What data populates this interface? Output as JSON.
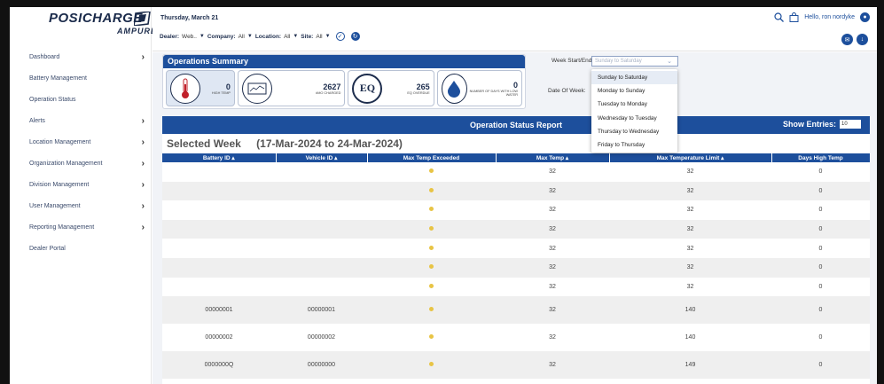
{
  "app": {
    "brand": "POSICHARGE",
    "sub_brand": "AMPURE"
  },
  "sidebar": {
    "items": [
      {
        "label": "Dashboard",
        "chevron": true
      },
      {
        "label": "Battery Management",
        "chevron": false
      },
      {
        "label": "Operation Status",
        "chevron": false
      },
      {
        "label": "Alerts",
        "chevron": true
      },
      {
        "label": "Location Management",
        "chevron": true
      },
      {
        "label": "Organization Management",
        "chevron": true
      },
      {
        "label": "Division Management",
        "chevron": true
      },
      {
        "label": "User Management",
        "chevron": true
      },
      {
        "label": "Reporting Management",
        "chevron": true
      },
      {
        "label": "Dealer Portal",
        "chevron": false
      }
    ]
  },
  "header": {
    "date": "Thursday, March 21",
    "greeting": "Hello, ron nordyke",
    "filters": {
      "dealer_label": "Dealer:",
      "dealer_value": "Web..",
      "company_label": "Company:",
      "company_value": "All",
      "location_label": "Location:",
      "location_value": "All",
      "site_label": "Site:",
      "site_value": "All"
    }
  },
  "operations_summary": {
    "title": "Operations Summary",
    "cards": [
      {
        "icon": "thermometer-icon",
        "value": "0",
        "label": "HIGH TEMP"
      },
      {
        "icon": "battery-chart-icon",
        "value": "2627",
        "label": "#mo Charged"
      },
      {
        "icon": "eq-icon",
        "value": "265",
        "label": "EQ OVERDUE"
      },
      {
        "icon": "water-drop-icon",
        "value": "0",
        "label": "NUMBER OF DAYS WITH LOW WATER"
      }
    ]
  },
  "week_filter": {
    "label": "Week Start/End:",
    "placeholder": "Sunday to Saturday",
    "date_of_week_label": "Date Of Week:",
    "options": [
      "Sunday to Saturday",
      "Monday to Sunday",
      "Tuesday to Monday",
      "Wednesday to Tuesday",
      "Thursday to Wednesday",
      "Friday to Thursday"
    ],
    "highlighted_index": 0
  },
  "report": {
    "title": "Operation Status Report",
    "show_entries_label": "Show Entries:",
    "show_entries_value": "10",
    "selected_week_label": "Selected Week",
    "selected_week_range": "(17-Mar-2024 to 24-Mar-2024)",
    "columns": [
      "Battery ID ▴",
      "Vehicle ID ▴",
      "Max Temp Exceeded",
      "Max Temp ▴",
      "Max Temperature Limit ▴",
      "Days High Temp"
    ],
    "rows": [
      {
        "battery": "",
        "vehicle": "",
        "max_temp": "32",
        "limit": "32",
        "days": "0"
      },
      {
        "battery": "",
        "vehicle": "",
        "max_temp": "32",
        "limit": "32",
        "days": "0"
      },
      {
        "battery": "",
        "vehicle": "",
        "max_temp": "32",
        "limit": "32",
        "days": "0"
      },
      {
        "battery": "",
        "vehicle": "",
        "max_temp": "32",
        "limit": "32",
        "days": "0"
      },
      {
        "battery": "",
        "vehicle": "",
        "max_temp": "32",
        "limit": "32",
        "days": "0"
      },
      {
        "battery": "",
        "vehicle": "",
        "max_temp": "32",
        "limit": "32",
        "days": "0"
      },
      {
        "battery": "",
        "vehicle": "",
        "max_temp": "32",
        "limit": "32",
        "days": "0"
      },
      {
        "battery": "00000001",
        "vehicle": "00000001",
        "max_temp": "32",
        "limit": "140",
        "days": "0"
      },
      {
        "battery": "00000002",
        "vehicle": "00000002",
        "max_temp": "32",
        "limit": "140",
        "days": "0"
      },
      {
        "battery": "0000000Q",
        "vehicle": "00000000",
        "max_temp": "32",
        "limit": "149",
        "days": "0"
      }
    ]
  },
  "colors": {
    "primary": "#1d4f9c",
    "dark_navy": "#1d2d4d",
    "status_dot": "#e8c445"
  }
}
